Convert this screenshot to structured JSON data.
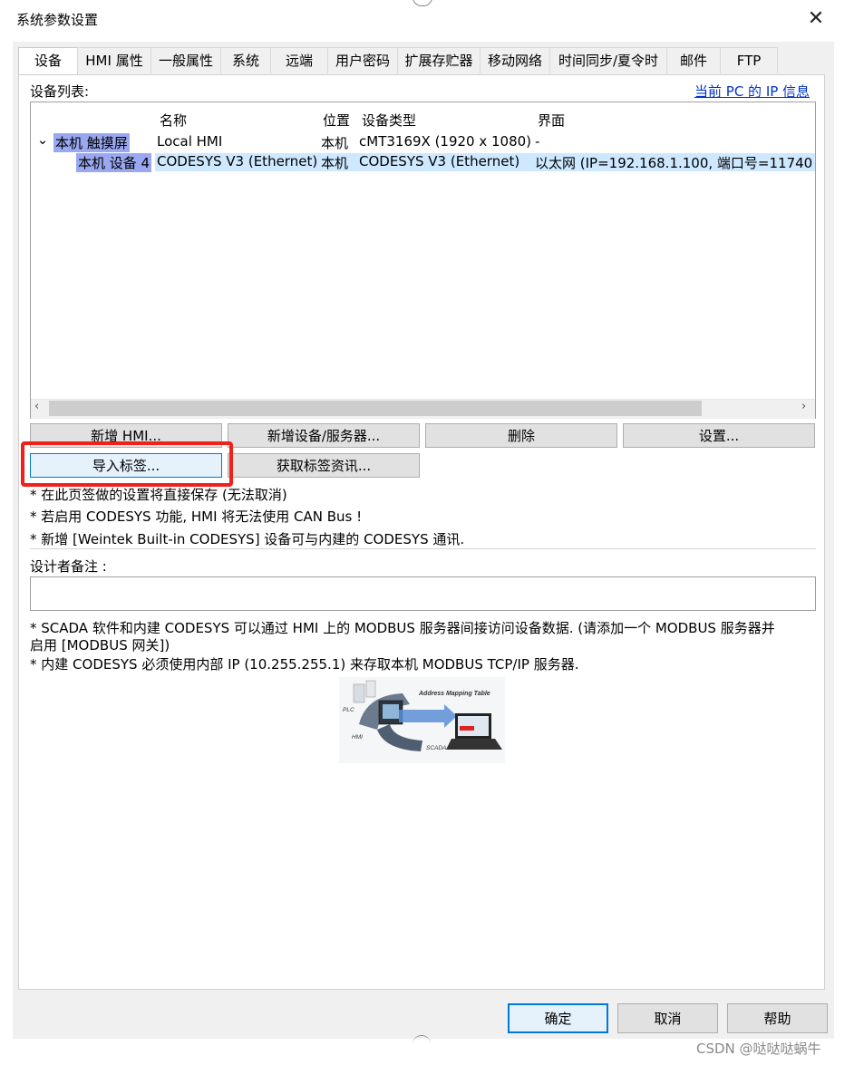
{
  "window": {
    "title": "系统参数设置",
    "close_glyph": "✕"
  },
  "tabs": [
    {
      "label": "设备",
      "active": true
    },
    {
      "label": "HMI 属性"
    },
    {
      "label": "一般属性"
    },
    {
      "label": "系统"
    },
    {
      "label": "远端"
    },
    {
      "label": "用户密码"
    },
    {
      "label": "扩展存贮器"
    },
    {
      "label": "移动网络"
    },
    {
      "label": "时间同步/夏令时"
    },
    {
      "label": "邮件"
    },
    {
      "label": "FTP"
    }
  ],
  "device_list": {
    "label": "设备列表:",
    "ip_link": "当前 PC 的 IP 信息",
    "columns": [
      "名称",
      "位置",
      "设备类型",
      "界面"
    ],
    "tree_toggle": "⌄",
    "rows": [
      {
        "node": "本机 触摸屏",
        "name": "Local HMI",
        "location": "本机",
        "type": "cMT3169X (1920 x 1080)",
        "interface": "-"
      },
      {
        "node": "本机 设备 4",
        "name": "CODESYS V3 (Ethernet)",
        "location": "本机",
        "type": "CODESYS V3 (Ethernet)",
        "interface": "以太网 (IP=192.168.1.100, 端口号=11740"
      }
    ],
    "scroll_left": "‹",
    "scroll_right": "›"
  },
  "buttons": {
    "add_hmi": "新增 HMI...",
    "add_device": "新增设备/服务器...",
    "delete": "删除",
    "settings": "设置...",
    "import_tags": "导入标签...",
    "get_tag_info": "获取标签资讯..."
  },
  "notes": [
    "* 在此页签做的设置将直接保存 (无法取消)",
    "* 若启用 CODESYS 功能, HMI 将无法使用 CAN Bus !",
    "* 新增 [Weintek Built-in CODESYS] 设备可与内建的 CODESYS 通讯."
  ],
  "designer_notes": {
    "label": "设计者备注 :",
    "value": ""
  },
  "scada_notes": [
    "* SCADA 软件和内建 CODESYS 可以通过 HMI 上的 MODBUS 服务器间接访问设备数据. (请添加一个 MODBUS 服务器并",
    "启用 [MODBUS 网关])",
    "* 内建 CODESYS 必须使用内部 IP (10.255.255.1) 来存取本机 MODBUS TCP/IP 服务器."
  ],
  "diagram": {
    "title": "Address Mapping Table",
    "plc": "PLC",
    "hmi": "HMI",
    "scada": "SCADA"
  },
  "footer": {
    "ok": "确定",
    "cancel": "取消",
    "help": "帮助"
  },
  "watermark": "CSDN @哒哒哒蜗牛",
  "colors": {
    "selection_purple": "#99a8f0",
    "selection_row": "#cde8ff",
    "highlight_red": "#f0201a",
    "link_blue": "#0033cc"
  }
}
